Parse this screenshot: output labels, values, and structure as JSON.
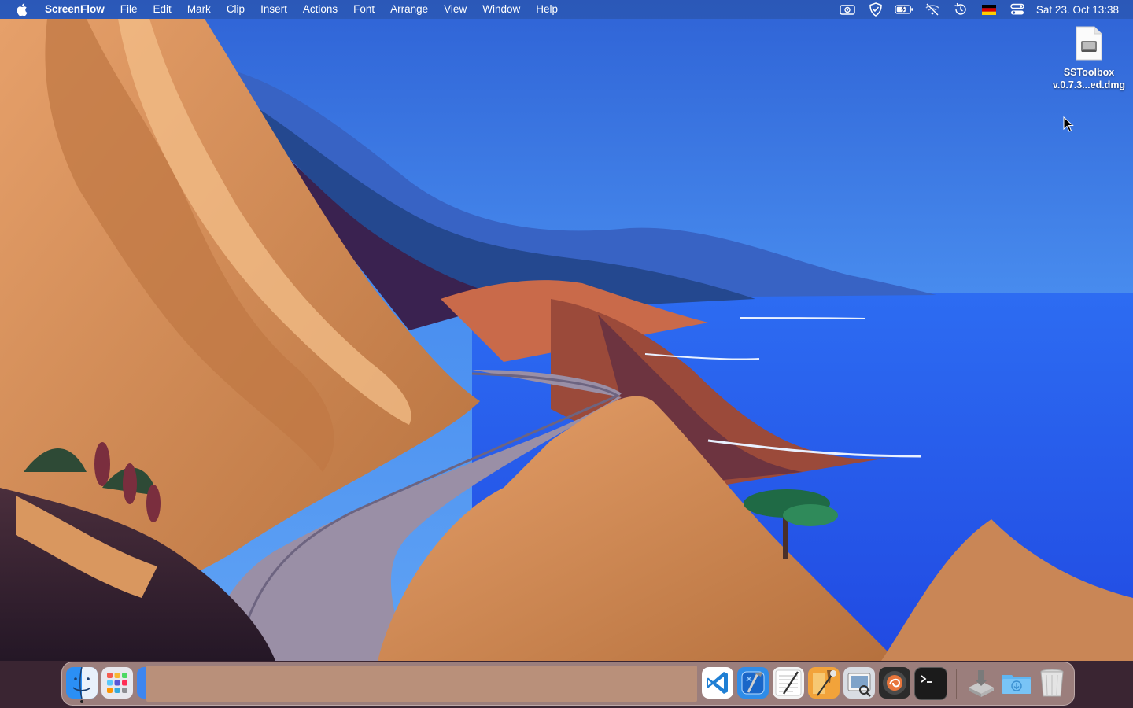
{
  "menubar": {
    "app_name": "ScreenFlow",
    "menus": [
      "File",
      "Edit",
      "Mark",
      "Clip",
      "Insert",
      "Actions",
      "Font",
      "Arrange",
      "View",
      "Window",
      "Help"
    ],
    "status_icons": [
      "screen-record-icon",
      "shield-icon",
      "battery-icon",
      "wifi-off-icon",
      "time-machine-icon",
      "flag-de-icon",
      "control-center-icon"
    ],
    "clock": "Sat 23. Oct  13:38"
  },
  "desktop_file": {
    "icon": "disk-image-icon",
    "name_line1": "SSToolbox",
    "name_line2": "v.0.7.3...ed.dmg"
  },
  "dock": {
    "items": [
      {
        "name": "finder",
        "icon": "finder-icon",
        "running": true
      },
      {
        "name": "launchpad",
        "icon": "launchpad-icon",
        "running": false
      },
      {
        "name": "app",
        "icon": "app-icon",
        "running": false
      },
      {
        "name": "vscode",
        "icon": "vscode-icon",
        "running": false
      },
      {
        "name": "xcode",
        "icon": "xcode-icon",
        "running": false
      },
      {
        "name": "textedit",
        "icon": "textedit-icon",
        "running": false
      },
      {
        "name": "brush",
        "icon": "paint-brush-icon",
        "running": false
      },
      {
        "name": "preview",
        "icon": "preview-icon",
        "running": false
      },
      {
        "name": "screenflow",
        "icon": "screenflow-icon",
        "running": false
      },
      {
        "name": "terminal",
        "icon": "terminal-icon",
        "running": false
      },
      {
        "name": "installer",
        "icon": "installer-icon",
        "running": false
      },
      {
        "name": "downloads",
        "icon": "downloads-folder-icon",
        "running": false
      },
      {
        "name": "trash",
        "icon": "trash-icon",
        "running": false
      }
    ]
  }
}
